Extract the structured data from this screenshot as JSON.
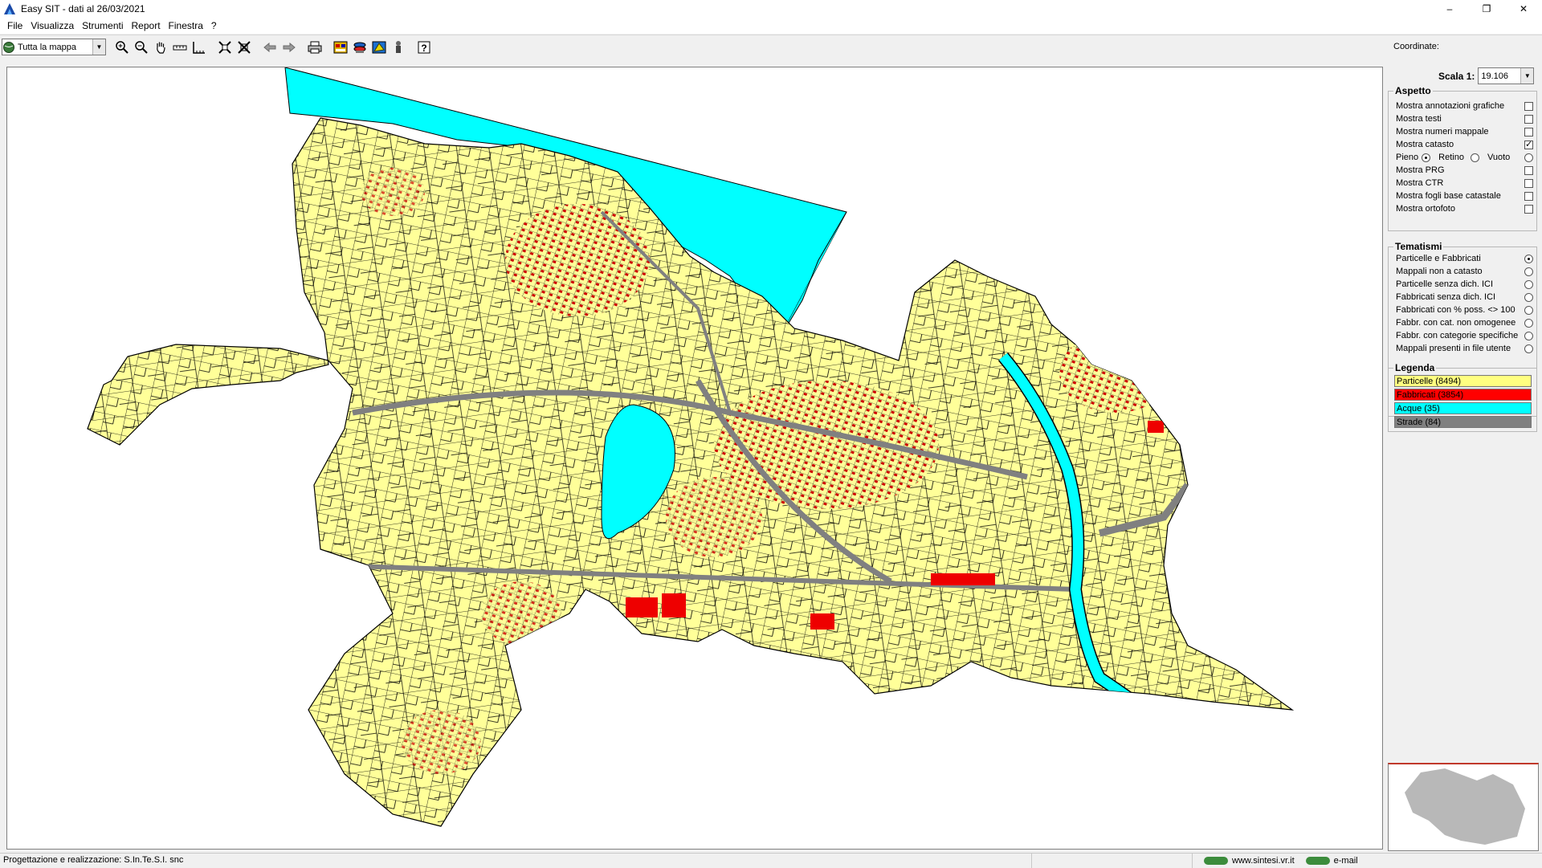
{
  "window": {
    "title": "Easy SIT - dati al 26/03/2021",
    "controls": [
      "–",
      "❐",
      "✕"
    ]
  },
  "menu": [
    "File",
    "Visualizza",
    "Strumenti",
    "Report",
    "Finestra",
    "?"
  ],
  "toolbar": {
    "view_select": "Tutta la mappa",
    "coordinates_label": "Coordinate:",
    "buttons": [
      "zoom-in",
      "zoom-out",
      "pan",
      "measure",
      "ruler",
      "zoom-extent",
      "zoom-full",
      "back",
      "forward",
      "print",
      "report",
      "layers",
      "info",
      "identify",
      "help"
    ]
  },
  "panel": {
    "scale_label": "Scala 1:",
    "scale_value": "19.106",
    "aspetto": {
      "title": "Aspetto",
      "options": [
        {
          "label": "Mostra annotazioni grafiche",
          "checked": false
        },
        {
          "label": "Mostra testi",
          "checked": false
        },
        {
          "label": "Mostra numeri mappale",
          "checked": false
        },
        {
          "label": "Mostra catasto",
          "checked": true
        }
      ],
      "fill_modes": [
        {
          "label": "Pieno",
          "selected": true
        },
        {
          "label": "Retino",
          "selected": false
        },
        {
          "label": "Vuoto",
          "selected": false
        }
      ],
      "options2": [
        {
          "label": "Mostra PRG",
          "checked": false
        },
        {
          "label": "Mostra CTR",
          "checked": false
        },
        {
          "label": "Mostra fogli base catastale",
          "checked": false
        },
        {
          "label": "Mostra ortofoto",
          "checked": false
        }
      ]
    },
    "tematismi": {
      "title": "Tematismi",
      "options": [
        {
          "label": "Particelle e Fabbricati",
          "selected": true
        },
        {
          "label": "Mappali non a catasto",
          "selected": false
        },
        {
          "label": "Particelle senza dich. ICI",
          "selected": false
        },
        {
          "label": "Fabbricati senza dich. ICI",
          "selected": false
        },
        {
          "label": "Fabbricati con % poss. <> 100",
          "selected": false
        },
        {
          "label": "Fabbr. con cat. non omogenee",
          "selected": false
        },
        {
          "label": "Fabbr. con categorie specifiche",
          "selected": false
        },
        {
          "label": "Mappali presenti in file utente",
          "selected": false
        }
      ]
    },
    "legenda": {
      "title": "Legenda",
      "items": [
        {
          "label": "Particelle (8494)",
          "color": "#ffff80",
          "text_color": "#000000"
        },
        {
          "label": "Fabbricati (3854)",
          "color": "#ff0000",
          "text_color": "#000000"
        },
        {
          "label": "Acque (35)",
          "color": "#00ffff",
          "text_color": "#000000"
        },
        {
          "label": "Strade (84)",
          "color": "#808080",
          "text_color": "#000000"
        }
      ]
    }
  },
  "map": {
    "colors": {
      "parcels": "#ffff99",
      "buildings": "#ee0000",
      "water": "#00ffff",
      "roads": "#808080"
    }
  },
  "status": {
    "text": "Progettazione e realizzazione: S.In.Te.S.I. snc",
    "website": "www.sintesi.vr.it",
    "email": "e-mail"
  }
}
